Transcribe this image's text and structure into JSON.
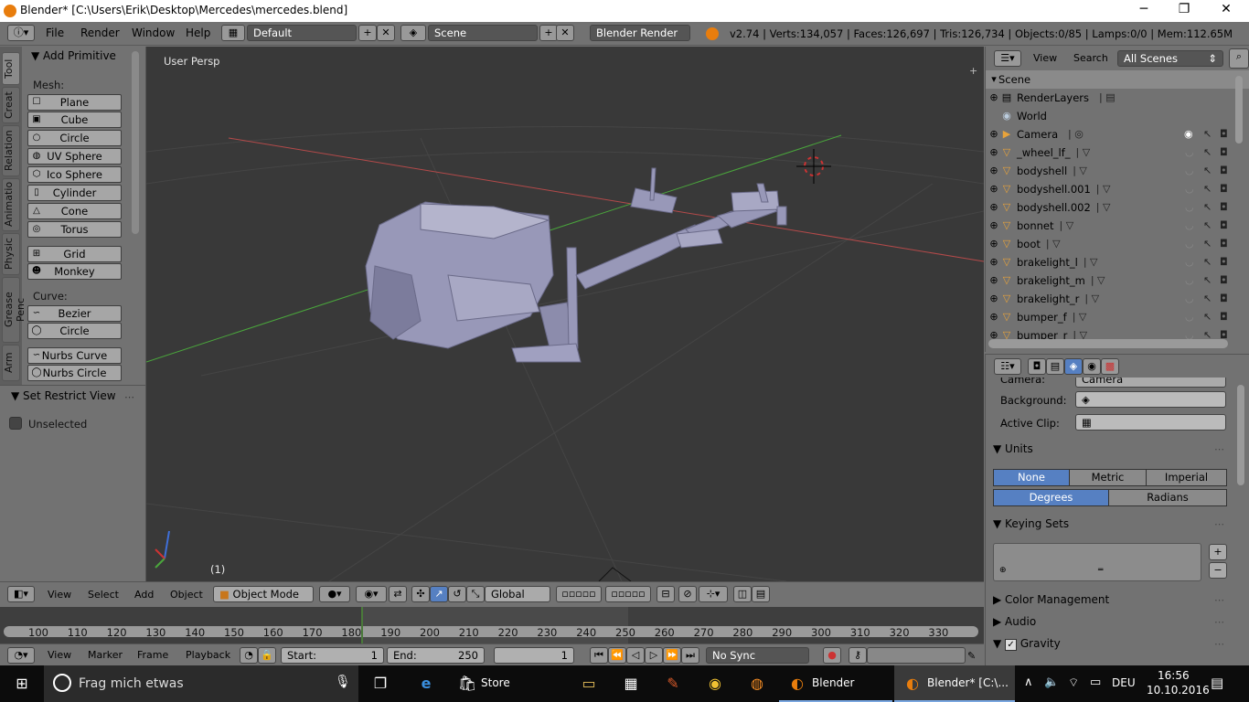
{
  "window": {
    "title": "Blender* [C:\\Users\\Erik\\Desktop\\Mercedes\\mercedes.blend]",
    "minimize": "─",
    "maximize": "❐",
    "close": "✕"
  },
  "info_header": {
    "menus": [
      "File",
      "Render",
      "Window",
      "Help"
    ],
    "layout": "Default",
    "scene": "Scene",
    "engine": "Blender Render",
    "stats": "v2.74 | Verts:134,057 | Faces:126,697 | Tris:126,734 | Objects:0/85 | Lamps:0/0 | Mem:112.65M"
  },
  "tool_shelf": {
    "tabs": [
      "Tool",
      "Creat",
      "Relation",
      "Animatio",
      "Physic",
      "Grease Penc",
      "Arm"
    ],
    "panel_title": "Add Primitive",
    "mesh_label": "Mesh:",
    "mesh_buttons": [
      "Plane",
      "Cube",
      "Circle",
      "UV Sphere",
      "Ico Sphere",
      "Cylinder",
      "Cone",
      "Torus"
    ],
    "extra_buttons": [
      "Grid",
      "Monkey"
    ],
    "curve_label": "Curve:",
    "curve_buttons": [
      "Bezier",
      "Circle"
    ],
    "nurbs_buttons": [
      "Nurbs Curve",
      "Nurbs Circle"
    ],
    "restrict_title": "Set Restrict View",
    "unselected_label": "Unselected"
  },
  "viewport": {
    "view_name": "User Persp",
    "frame_indicator": "(1)"
  },
  "view3d_header": {
    "menus": [
      "View",
      "Select",
      "Add",
      "Object"
    ],
    "mode": "Object Mode",
    "orientation": "Global"
  },
  "timeline": {
    "ticks": [
      "100",
      "110",
      "120",
      "130",
      "140",
      "150",
      "160",
      "170",
      "180",
      "190",
      "200",
      "210",
      "220",
      "230",
      "240",
      "250",
      "260",
      "270",
      "280",
      "290",
      "300",
      "310",
      "320",
      "330"
    ],
    "menus": [
      "View",
      "Marker",
      "Frame",
      "Playback"
    ],
    "start_label": "Start:",
    "start_value": "1",
    "end_label": "End:",
    "end_value": "250",
    "current_frame": "1",
    "sync": "No Sync"
  },
  "outliner": {
    "menus": [
      "View",
      "Search"
    ],
    "filter": "All Scenes",
    "items": [
      {
        "name": "Scene",
        "icon": "scene-icon"
      },
      {
        "name": "RenderLayers",
        "icon": "renderlayers-icon"
      },
      {
        "name": "World",
        "icon": "world-icon"
      },
      {
        "name": "Camera",
        "icon": "camera-icon"
      },
      {
        "name": "_wheel_lf_",
        "icon": "mesh-icon"
      },
      {
        "name": "bodyshell",
        "icon": "mesh-icon"
      },
      {
        "name": "bodyshell.001",
        "icon": "mesh-icon"
      },
      {
        "name": "bodyshell.002",
        "icon": "mesh-icon"
      },
      {
        "name": "bonnet",
        "icon": "mesh-icon"
      },
      {
        "name": "boot",
        "icon": "mesh-icon"
      },
      {
        "name": "brakelight_l",
        "icon": "mesh-icon"
      },
      {
        "name": "brakelight_m",
        "icon": "mesh-icon"
      },
      {
        "name": "brakelight_r",
        "icon": "mesh-icon"
      },
      {
        "name": "bumper_f",
        "icon": "mesh-icon"
      },
      {
        "name": "bumper_r",
        "icon": "mesh-icon"
      }
    ]
  },
  "properties": {
    "camera_label": "Camera:",
    "camera_value": "Camera",
    "background_label": "Background:",
    "active_clip_label": "Active Clip:",
    "units_title": "Units",
    "unit_systems": [
      "None",
      "Metric",
      "Imperial"
    ],
    "rotation_units": [
      "Degrees",
      "Radians"
    ],
    "keying_sets_title": "Keying Sets",
    "color_management_title": "Color Management",
    "audio_title": "Audio",
    "gravity_title": "Gravity"
  },
  "taskbar": {
    "search_placeholder": "Frag mich etwas",
    "store_label": "Store",
    "blender_label": "Blender",
    "blender_window_label": "Blender* [C:\\...",
    "language": "DEU",
    "time": "16:56",
    "date": "10.10.2016"
  },
  "colors": {
    "axis_red": "#b44a4a",
    "axis_green": "#4aa63c",
    "selection_blue": "#5680c2",
    "mesh_orange": "#e8a33a"
  }
}
